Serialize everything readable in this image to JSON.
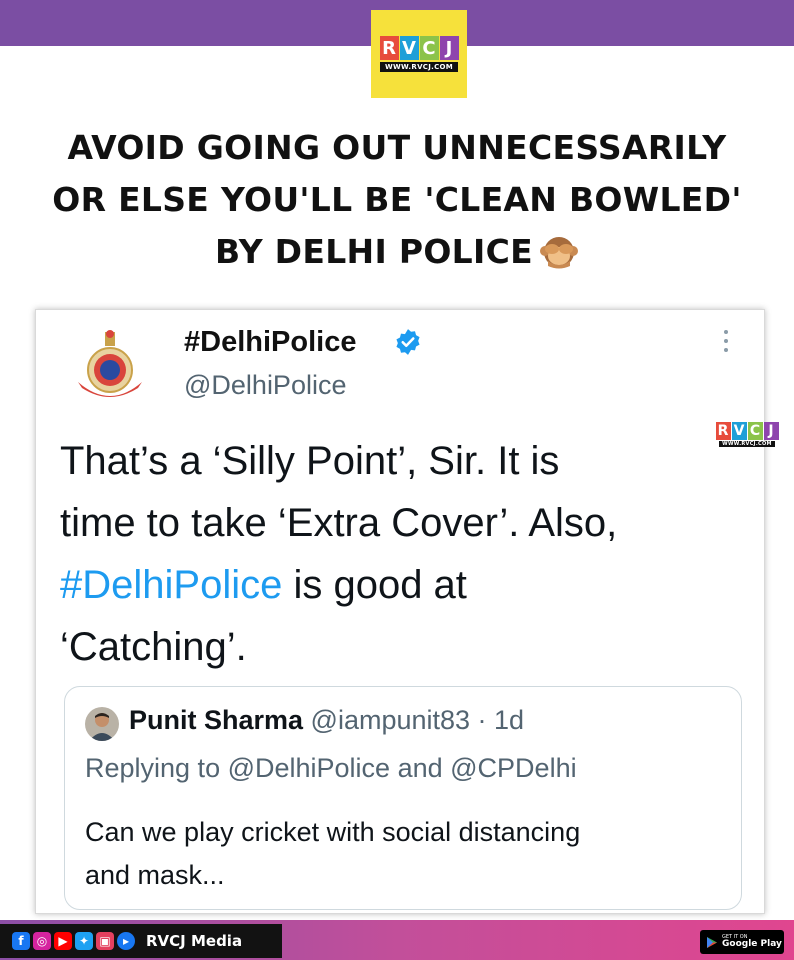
{
  "brand": {
    "logo_letters": [
      "R",
      "V",
      "C",
      "J"
    ],
    "logo_colors": [
      "#e74c3c",
      "#1e9fd8",
      "#8bc34a",
      "#8e44ad"
    ],
    "logo_url": "WWW.RVCJ.COM",
    "background": "#f6e13b",
    "band_color": "#7b4ea3"
  },
  "headline": {
    "line1": "AVOID GOING OUT UNNECESSARILY",
    "line2": "OR ELSE YOU'LL BE 'CLEAN BOWLED'",
    "line3": "BY DELHI POLICE",
    "emoji": "see-no-evil-monkey-icon"
  },
  "tweet": {
    "display_name": "#DelhiPolice",
    "handle": "@DelhiPolice",
    "body_line1": "That’s a ‘Silly Point’, Sir.  It is",
    "body_line2": "time to take ‘Extra Cover’. Also,",
    "body_hashtag": "#DelhiPolice",
    "body_line3_rest": " is good at",
    "body_line4": "‘Catching’.",
    "link_color": "#1d9bf0",
    "quoted": {
      "name": "Punit Sharma",
      "handle_time": " @iampunit83 · 1d",
      "reply_prefix": "Replying to ",
      "mention1": "@DelhiPolice",
      "reply_and": " and ",
      "mention2": "@CPDelhi",
      "text_line1": "Can we play cricket with social distancing",
      "text_line2": "and mask..."
    }
  },
  "footer": {
    "social_icons": [
      "facebook-icon",
      "instagram-icon",
      "youtube-icon",
      "twitter-icon",
      "tv-icon",
      "play-icon"
    ],
    "label": "RVCJ Media",
    "store_small": "GET IT ON",
    "store_big": "Google Play"
  }
}
